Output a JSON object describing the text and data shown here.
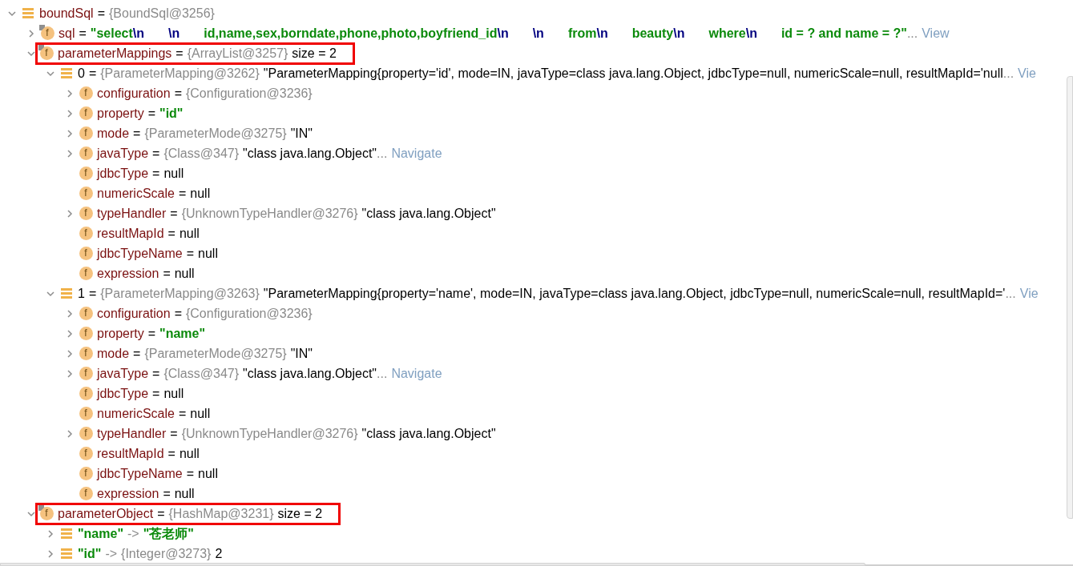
{
  "variables": [
    {
      "name": "boundSql",
      "kind": "object",
      "final": false,
      "highlighted": false,
      "expanded": true,
      "separator": "=",
      "parts": [
        {
          "kind": "type",
          "text": "{BoundSql@3256}"
        }
      ],
      "children": [
        {
          "name": "sql",
          "kind": "field",
          "icon_letter": "f",
          "final": true,
          "highlighted": false,
          "expanded": false,
          "separator": "=",
          "parts": [
            {
              "kind": "string",
              "text": "\"select"
            },
            {
              "kind": "escape",
              "text": "\\n"
            },
            {
              "kind": "escape",
              "text": "\\n"
            },
            {
              "kind": "string",
              "text": "id,name,sex,borndate,phone,photo,boyfriend_id"
            },
            {
              "kind": "escape",
              "text": "\\n"
            },
            {
              "kind": "escape",
              "text": "\\n"
            },
            {
              "kind": "string",
              "text": "from"
            },
            {
              "kind": "escape",
              "text": "\\n"
            },
            {
              "kind": "string",
              "text": "beauty"
            },
            {
              "kind": "escape",
              "text": "\\n"
            },
            {
              "kind": "string",
              "text": "where"
            },
            {
              "kind": "escape",
              "text": "\\n"
            },
            {
              "kind": "string",
              "text": "id = ? and name = ?\""
            },
            {
              "kind": "more",
              "text": "..."
            },
            {
              "kind": "link",
              "text": "View"
            }
          ]
        },
        {
          "name": "parameterMappings",
          "kind": "field",
          "icon_letter": "f",
          "final": true,
          "highlighted": true,
          "expanded": true,
          "separator": "=",
          "parts": [
            {
              "kind": "type",
              "text": "{ArrayList@3257}"
            },
            {
              "kind": "plain",
              "text": "size = 2"
            }
          ],
          "children": [
            {
              "name": "0",
              "kind": "element",
              "final": false,
              "highlighted": false,
              "expanded": true,
              "separator": "=",
              "parts": [
                {
                  "kind": "type",
                  "text": "{ParameterMapping@3262}"
                },
                {
                  "kind": "plain",
                  "text": "\"ParameterMapping{property='id', mode=IN, javaType=class java.lang.Object, jdbcType=null, numericScale=null, resultMapId='null"
                },
                {
                  "kind": "more",
                  "text": "..."
                },
                {
                  "kind": "link",
                  "text": "Vie"
                }
              ],
              "children": [
                {
                  "name": "configuration",
                  "kind": "field",
                  "icon_letter": "f",
                  "final": false,
                  "highlighted": false,
                  "expanded": false,
                  "separator": "=",
                  "parts": [
                    {
                      "kind": "type",
                      "text": "{Configuration@3236}"
                    }
                  ]
                },
                {
                  "name": "property",
                  "kind": "field",
                  "icon_letter": "f",
                  "final": false,
                  "highlighted": false,
                  "expanded": false,
                  "separator": "=",
                  "parts": [
                    {
                      "kind": "string",
                      "text": "\"id\""
                    }
                  ]
                },
                {
                  "name": "mode",
                  "kind": "field",
                  "icon_letter": "f",
                  "final": false,
                  "highlighted": false,
                  "expanded": false,
                  "separator": "=",
                  "parts": [
                    {
                      "kind": "type",
                      "text": "{ParameterMode@3275}"
                    },
                    {
                      "kind": "plain",
                      "text": "\"IN\""
                    }
                  ]
                },
                {
                  "name": "javaType",
                  "kind": "field",
                  "icon_letter": "f",
                  "final": false,
                  "highlighted": false,
                  "expanded": false,
                  "separator": "=",
                  "parts": [
                    {
                      "kind": "type",
                      "text": "{Class@347}"
                    },
                    {
                      "kind": "plain",
                      "text": "\"class java.lang.Object\""
                    },
                    {
                      "kind": "more",
                      "text": "..."
                    },
                    {
                      "kind": "link",
                      "text": "Navigate"
                    }
                  ]
                },
                {
                  "name": "jdbcType",
                  "kind": "field",
                  "icon_letter": "f",
                  "final": false,
                  "highlighted": false,
                  "separator": "=",
                  "parts": [
                    {
                      "kind": "plain",
                      "text": "null"
                    }
                  ]
                },
                {
                  "name": "numericScale",
                  "kind": "field",
                  "icon_letter": "f",
                  "final": false,
                  "highlighted": false,
                  "separator": "=",
                  "parts": [
                    {
                      "kind": "plain",
                      "text": "null"
                    }
                  ]
                },
                {
                  "name": "typeHandler",
                  "kind": "field",
                  "icon_letter": "f",
                  "final": false,
                  "highlighted": false,
                  "expanded": false,
                  "separator": "=",
                  "parts": [
                    {
                      "kind": "type",
                      "text": "{UnknownTypeHandler@3276}"
                    },
                    {
                      "kind": "plain",
                      "text": "\"class java.lang.Object\""
                    }
                  ]
                },
                {
                  "name": "resultMapId",
                  "kind": "field",
                  "icon_letter": "f",
                  "final": false,
                  "highlighted": false,
                  "separator": "=",
                  "parts": [
                    {
                      "kind": "plain",
                      "text": "null"
                    }
                  ]
                },
                {
                  "name": "jdbcTypeName",
                  "kind": "field",
                  "icon_letter": "f",
                  "final": false,
                  "highlighted": false,
                  "separator": "=",
                  "parts": [
                    {
                      "kind": "plain",
                      "text": "null"
                    }
                  ]
                },
                {
                  "name": "expression",
                  "kind": "field",
                  "icon_letter": "f",
                  "final": false,
                  "highlighted": false,
                  "separator": "=",
                  "parts": [
                    {
                      "kind": "plain",
                      "text": "null"
                    }
                  ]
                }
              ]
            },
            {
              "name": "1",
              "kind": "element",
              "final": false,
              "highlighted": false,
              "expanded": true,
              "separator": "=",
              "parts": [
                {
                  "kind": "type",
                  "text": "{ParameterMapping@3263}"
                },
                {
                  "kind": "plain",
                  "text": "\"ParameterMapping{property='name', mode=IN, javaType=class java.lang.Object, jdbcType=null, numericScale=null, resultMapId='"
                },
                {
                  "kind": "more",
                  "text": "..."
                },
                {
                  "kind": "link",
                  "text": "Vie"
                }
              ],
              "children": [
                {
                  "name": "configuration",
                  "kind": "field",
                  "icon_letter": "f",
                  "final": false,
                  "highlighted": false,
                  "expanded": false,
                  "separator": "=",
                  "parts": [
                    {
                      "kind": "type",
                      "text": "{Configuration@3236}"
                    }
                  ]
                },
                {
                  "name": "property",
                  "kind": "field",
                  "icon_letter": "f",
                  "final": false,
                  "highlighted": false,
                  "expanded": false,
                  "separator": "=",
                  "parts": [
                    {
                      "kind": "string",
                      "text": "\"name\""
                    }
                  ]
                },
                {
                  "name": "mode",
                  "kind": "field",
                  "icon_letter": "f",
                  "final": false,
                  "highlighted": false,
                  "expanded": false,
                  "separator": "=",
                  "parts": [
                    {
                      "kind": "type",
                      "text": "{ParameterMode@3275}"
                    },
                    {
                      "kind": "plain",
                      "text": "\"IN\""
                    }
                  ]
                },
                {
                  "name": "javaType",
                  "kind": "field",
                  "icon_letter": "f",
                  "final": false,
                  "highlighted": false,
                  "expanded": false,
                  "separator": "=",
                  "parts": [
                    {
                      "kind": "type",
                      "text": "{Class@347}"
                    },
                    {
                      "kind": "plain",
                      "text": "\"class java.lang.Object\""
                    },
                    {
                      "kind": "more",
                      "text": "..."
                    },
                    {
                      "kind": "link",
                      "text": "Navigate"
                    }
                  ]
                },
                {
                  "name": "jdbcType",
                  "kind": "field",
                  "icon_letter": "f",
                  "final": false,
                  "highlighted": false,
                  "separator": "=",
                  "parts": [
                    {
                      "kind": "plain",
                      "text": "null"
                    }
                  ]
                },
                {
                  "name": "numericScale",
                  "kind": "field",
                  "icon_letter": "f",
                  "final": false,
                  "highlighted": false,
                  "separator": "=",
                  "parts": [
                    {
                      "kind": "plain",
                      "text": "null"
                    }
                  ]
                },
                {
                  "name": "typeHandler",
                  "kind": "field",
                  "icon_letter": "f",
                  "final": false,
                  "highlighted": false,
                  "expanded": false,
                  "separator": "=",
                  "parts": [
                    {
                      "kind": "type",
                      "text": "{UnknownTypeHandler@3276}"
                    },
                    {
                      "kind": "plain",
                      "text": "\"class java.lang.Object\""
                    }
                  ]
                },
                {
                  "name": "resultMapId",
                  "kind": "field",
                  "icon_letter": "f",
                  "final": false,
                  "highlighted": false,
                  "separator": "=",
                  "parts": [
                    {
                      "kind": "plain",
                      "text": "null"
                    }
                  ]
                },
                {
                  "name": "jdbcTypeName",
                  "kind": "field",
                  "icon_letter": "f",
                  "final": false,
                  "highlighted": false,
                  "separator": "=",
                  "parts": [
                    {
                      "kind": "plain",
                      "text": "null"
                    }
                  ]
                },
                {
                  "name": "expression",
                  "kind": "field",
                  "icon_letter": "f",
                  "final": false,
                  "highlighted": false,
                  "separator": "=",
                  "parts": [
                    {
                      "kind": "plain",
                      "text": "null"
                    }
                  ]
                }
              ]
            }
          ]
        },
        {
          "name": "parameterObject",
          "kind": "field",
          "icon_letter": "f",
          "final": true,
          "highlighted": true,
          "expanded": true,
          "separator": "=",
          "parts": [
            {
              "kind": "type",
              "text": "{HashMap@3231}"
            },
            {
              "kind": "plain",
              "text": "size = 2"
            }
          ],
          "children": [
            {
              "name": "\"name\"",
              "kind": "entry",
              "final": false,
              "highlighted": false,
              "expanded": false,
              "separator": "->",
              "parts": [
                {
                  "kind": "string",
                  "text": "\"苍老师\""
                }
              ]
            },
            {
              "name": "\"id\"",
              "kind": "entry",
              "final": false,
              "highlighted": false,
              "expanded": false,
              "separator": "->",
              "parts": [
                {
                  "kind": "type",
                  "text": "{Integer@3273}"
                },
                {
                  "kind": "plain",
                  "text": "2"
                }
              ]
            }
          ]
        }
      ]
    }
  ]
}
